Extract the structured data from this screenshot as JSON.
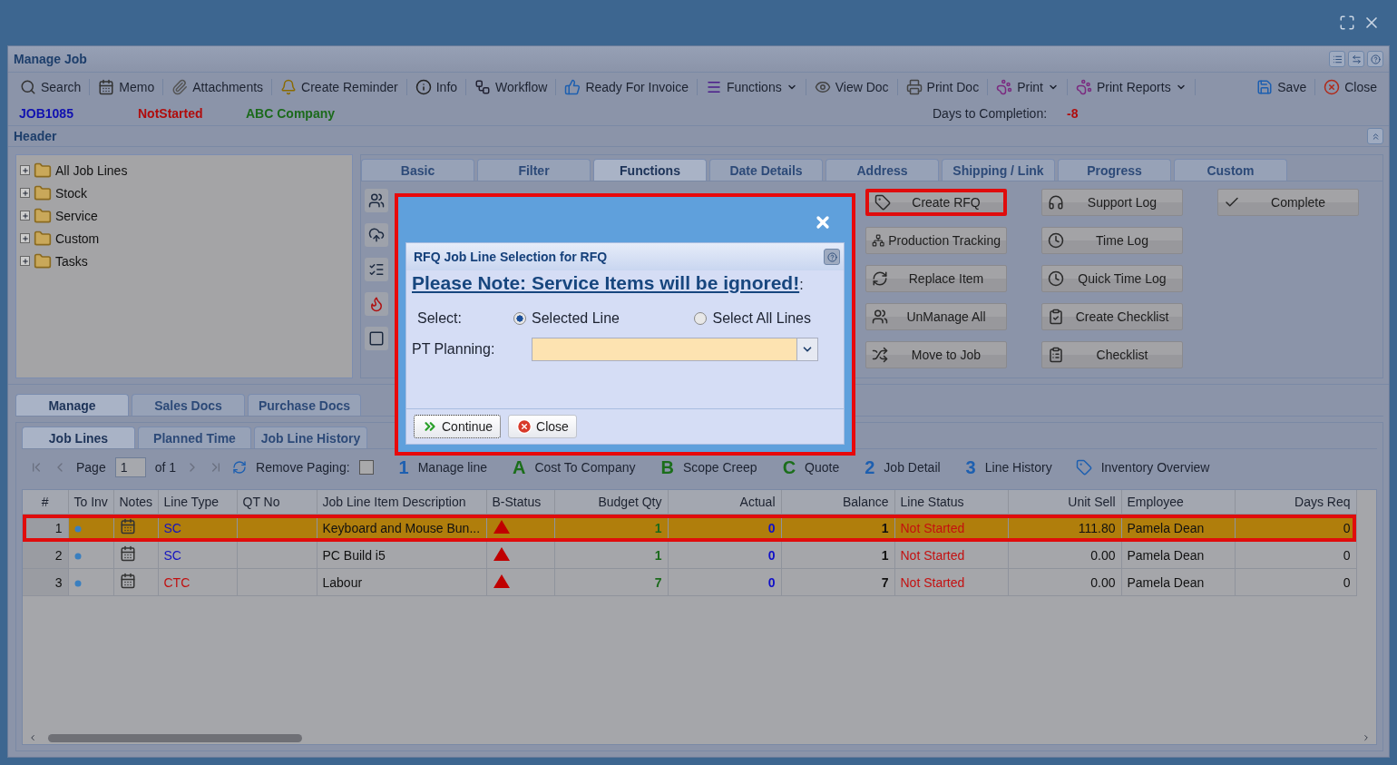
{
  "window": {
    "title": "Manage Job"
  },
  "toolbar": [
    {
      "label": "Search",
      "dropdown": false
    },
    {
      "label": "Memo",
      "dropdown": false
    },
    {
      "label": "Attachments",
      "dropdown": false
    },
    {
      "label": "Create Reminder",
      "dropdown": false
    },
    {
      "label": "Info",
      "dropdown": false
    },
    {
      "label": "Workflow",
      "dropdown": false
    },
    {
      "label": "Ready For Invoice",
      "dropdown": false
    },
    {
      "label": "Functions",
      "dropdown": true
    },
    {
      "label": "View Doc",
      "dropdown": false
    },
    {
      "label": "Print Doc",
      "dropdown": false
    },
    {
      "label": "Print",
      "dropdown": true
    },
    {
      "label": "Print Reports",
      "dropdown": true
    },
    {
      "label": "Save",
      "dropdown": false
    },
    {
      "label": "Close",
      "dropdown": false
    }
  ],
  "job": {
    "number": "JOB1085",
    "status": "NotStarted",
    "customer": "ABC Company",
    "days_label": "Days to Completion:",
    "days_value": "-8"
  },
  "section": {
    "title": "Header"
  },
  "tree": [
    {
      "label": "All Job Lines",
      "expanded": false
    },
    {
      "label": "Stock",
      "expanded": false
    },
    {
      "label": "Service",
      "expanded": false
    },
    {
      "label": "Custom",
      "expanded": false
    },
    {
      "label": "Tasks",
      "expanded": false
    }
  ],
  "top_tabs": [
    {
      "label": "Basic",
      "selected": false
    },
    {
      "label": "Filter",
      "selected": false
    },
    {
      "label": "Functions",
      "selected": true
    },
    {
      "label": "Date Details",
      "selected": false
    },
    {
      "label": "Address",
      "selected": false
    },
    {
      "label": "Shipping / Link",
      "selected": false
    },
    {
      "label": "Progress",
      "selected": false
    },
    {
      "label": "Custom",
      "selected": false
    }
  ],
  "function_columns": [
    [
      {
        "label": "Create RFQ",
        "highlighted": true
      },
      {
        "label": "Production Tracking",
        "highlighted": false
      },
      {
        "label": "Replace Item",
        "highlighted": false
      },
      {
        "label": "UnManage All",
        "highlighted": false
      },
      {
        "label": "Move to Job",
        "highlighted": false
      }
    ],
    [
      {
        "label": "Support Log",
        "highlighted": false
      },
      {
        "label": "Time Log",
        "highlighted": false
      },
      {
        "label": "Quick Time Log",
        "highlighted": false
      },
      {
        "label": "Create Checklist",
        "highlighted": false
      },
      {
        "label": "Checklist",
        "highlighted": false
      }
    ],
    [
      {
        "label": "Complete",
        "highlighted": false
      }
    ]
  ],
  "bottom_tabs": [
    {
      "label": "Manage",
      "selected": true
    },
    {
      "label": "Sales Docs",
      "selected": false
    },
    {
      "label": "Purchase Docs",
      "selected": false
    }
  ],
  "sub_tabs": [
    {
      "label": "Job Lines",
      "selected": true
    },
    {
      "label": "Planned Time",
      "selected": false
    },
    {
      "label": "Job Line History",
      "selected": false
    }
  ],
  "pager": {
    "page_label": "Page",
    "page_value": "1",
    "of": "of 1",
    "remove_paging": "Remove Paging:",
    "remove_paging_checked": false
  },
  "legend": [
    {
      "key": "1",
      "label": "Manage line",
      "color": "#1d5fb0"
    },
    {
      "key": "A",
      "label": "Cost To Company",
      "color": "#1b6e1b"
    },
    {
      "key": "B",
      "label": "Scope Creep",
      "color": "#1b6e1b"
    },
    {
      "key": "C",
      "label": "Quote",
      "color": "#1b6e1b"
    },
    {
      "key": "2",
      "label": "Job Detail",
      "color": "#1d5fb0"
    },
    {
      "key": "3",
      "label": "Line History",
      "color": "#1d5fb0"
    }
  ],
  "inventory": "Inventory Overview",
  "table": {
    "columns": [
      "#",
      "To Inv",
      "Notes",
      "Line Type",
      "QT No",
      "Job Line Item Description",
      "B-Status",
      "Budget Qty",
      "Actual",
      "Balance",
      "Line Status",
      "Unit Sell",
      "Employee",
      "Days Req"
    ],
    "rows": [
      {
        "num": "1",
        "line_type": {
          "text": "SC",
          "color": "#1414c0"
        },
        "description": "Keyboard and Mouse Bun...",
        "budget_qty": "1",
        "actual": "0",
        "balance": "1",
        "line_status": "Not Started",
        "unit_sell": "111.80",
        "employee": "Pamela Dean",
        "days_req": "0",
        "selected": true,
        "highlighted": true
      },
      {
        "num": "2",
        "line_type": {
          "text": "SC",
          "color": "#1414c0"
        },
        "description": "PC Build i5",
        "budget_qty": "1",
        "actual": "0",
        "balance": "1",
        "line_status": "Not Started",
        "unit_sell": "0.00",
        "employee": "Pamela Dean",
        "days_req": "0",
        "selected": false,
        "highlighted": false
      },
      {
        "num": "3",
        "line_type": {
          "text": "CTC",
          "color": "#c01010"
        },
        "description": "Labour",
        "budget_qty": "7",
        "actual": "0",
        "balance": "7",
        "line_status": "Not Started",
        "unit_sell": "0.00",
        "employee": "Pamela Dean",
        "days_req": "0",
        "selected": false,
        "highlighted": false
      }
    ]
  },
  "dialog": {
    "title": "RFQ Job Line Selection for RFQ",
    "note": "Please Note: Service Items will be ignored!",
    "note_suffix": ":",
    "select_label": "Select:",
    "options": [
      {
        "label": "Selected Line",
        "selected": true
      },
      {
        "label": "Select All Lines",
        "selected": false
      }
    ],
    "planning_label": "PT Planning:",
    "buttons": [
      "Continue",
      "Close"
    ],
    "highlighted": true
  }
}
